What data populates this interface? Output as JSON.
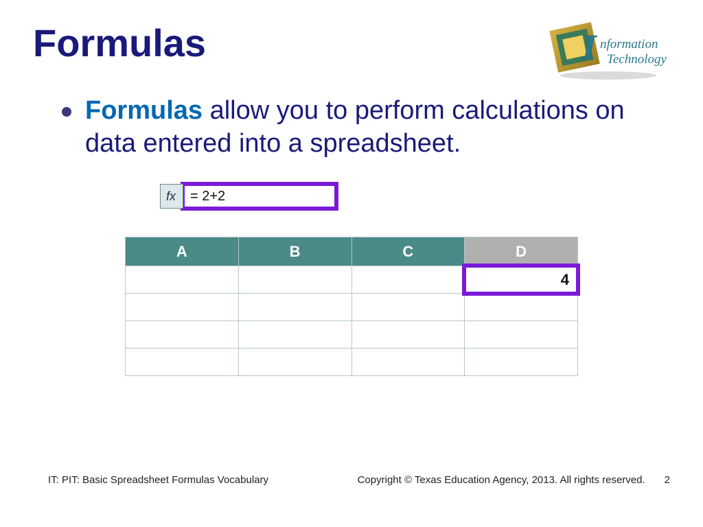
{
  "title": "Formulas",
  "logo": {
    "line1": "Information",
    "line2": "Technology"
  },
  "bullet": {
    "highlight": "Formulas",
    "rest": " allow you to perform calculations on data entered into a spreadsheet."
  },
  "formula_bar": {
    "fx_label": "fx",
    "value": "= 2+2"
  },
  "table": {
    "headers": [
      "A",
      "B",
      "C",
      "D"
    ],
    "result_cell_value": "4"
  },
  "footer": {
    "left": "IT: PIT: Basic Spreadsheet Formulas Vocabulary",
    "copyright": "Copyright © Texas Education Agency, 2013. All rights reserved.",
    "page": "2"
  }
}
